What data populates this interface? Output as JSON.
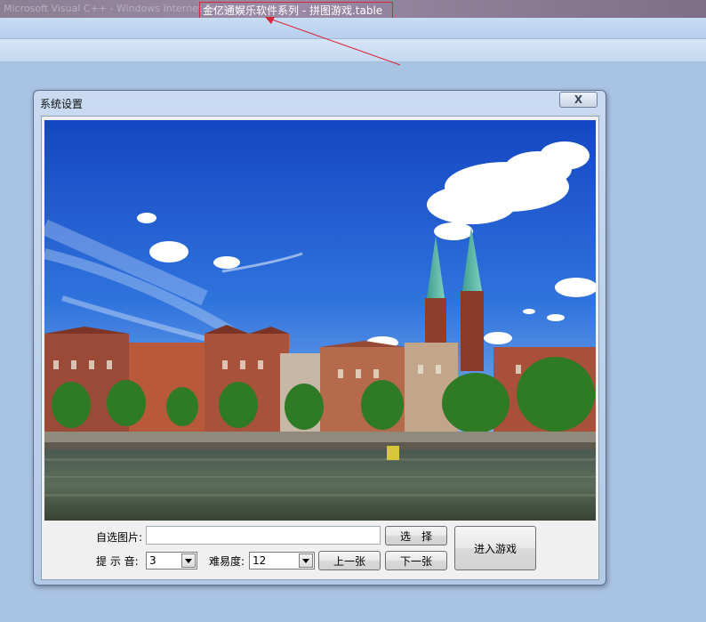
{
  "window": {
    "faded_title": "Microsoft Visual C++ - Windows Internet Explorer",
    "title": "金亿通娱乐软件系列 - 拼图游戏.table"
  },
  "dialog": {
    "title": "系统设置",
    "close_label": "X"
  },
  "form": {
    "custom_image_label": "自选图片:",
    "custom_image_value": "",
    "select_button": "选　择",
    "enter_game_button": "进入游戏",
    "sound_label": "提 示 音:",
    "sound_value": "3",
    "difficulty_label": "难易度:",
    "difficulty_value": "12",
    "prev_button": "上一张",
    "next_button": "下一张"
  },
  "colors": {
    "annotation_red": "#d9253a",
    "desktop": "#a9c3e3"
  }
}
